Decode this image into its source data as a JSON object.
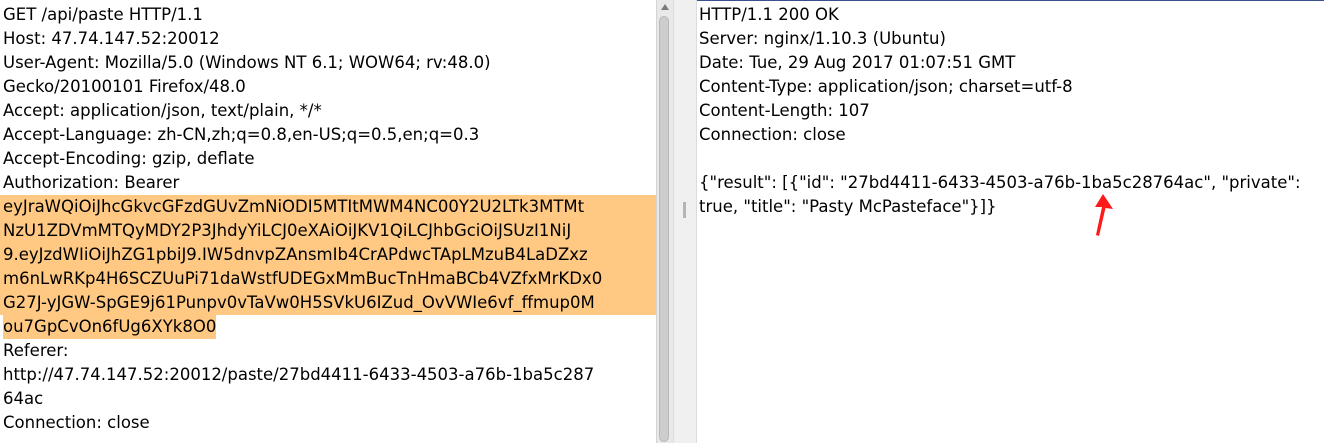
{
  "request": {
    "lines": [
      "GET /api/paste HTTP/1.1",
      "Host: 47.74.147.52:20012",
      "User-Agent: Mozilla/5.0 (Windows NT 6.1; WOW64; rv:48.0)",
      "Gecko/20100101 Firefox/48.0",
      "Accept: application/json, text/plain, */*",
      "Accept-Language: zh-CN,zh;q=0.8,en-US;q=0.5,en;q=0.3",
      "Accept-Encoding: gzip, deflate",
      "Authorization: Bearer"
    ],
    "token_lines": [
      "eyJraWQiOiJhcGkvcGFzdGUvZmNiODI5MTItMWM4NC00Y2U2LTk3MTMt",
      "NzU1ZDVmMTQyMDY2P3JhdyYiLCJ0eXAiOiJKV1QiLCJhbGciOiJSUzI1NiJ",
      "9.eyJzdWIiOiJhZG1pbiJ9.IW5dnvpZAnsmIb4CrAPdwcTApLMzuB4LaDZxz",
      "m6nLwRKp4H6SCZUuPi71daWstfUDEGxMmBucTnHmaBCb4VZfxMrKDx0",
      "G27J-yJGW-SpGE9j61Punpv0vTaVw0H5SVkU6IZud_OvVWIe6vf_ffmup0M",
      "ou7GpCvOn6fUg6XYk8O0"
    ],
    "after_lines": [
      "Referer:",
      "http://47.74.147.52:20012/paste/27bd4411-6433-4503-a76b-1ba5c287",
      "64ac",
      "Connection: close"
    ],
    "highlight_color": "#ffc983"
  },
  "response": {
    "lines": [
      "HTTP/1.1 200 OK",
      "Server: nginx/1.10.3 (Ubuntu)",
      "Date: Tue, 29 Aug 2017 01:07:51 GMT",
      "Content-Type: application/json; charset=utf-8",
      "Content-Length: 107",
      "Connection: close"
    ],
    "body_lines": [
      "{\"result\": [{\"id\": \"27bd4411-6433-4503-a76b-1ba5c28764ac\", \"private\":",
      "true, \"title\": \"Pasty McPasteface\"}]}"
    ]
  },
  "annotation": {
    "arrow_color": "#ff1a1a",
    "icon": "red-arrow-icon"
  }
}
